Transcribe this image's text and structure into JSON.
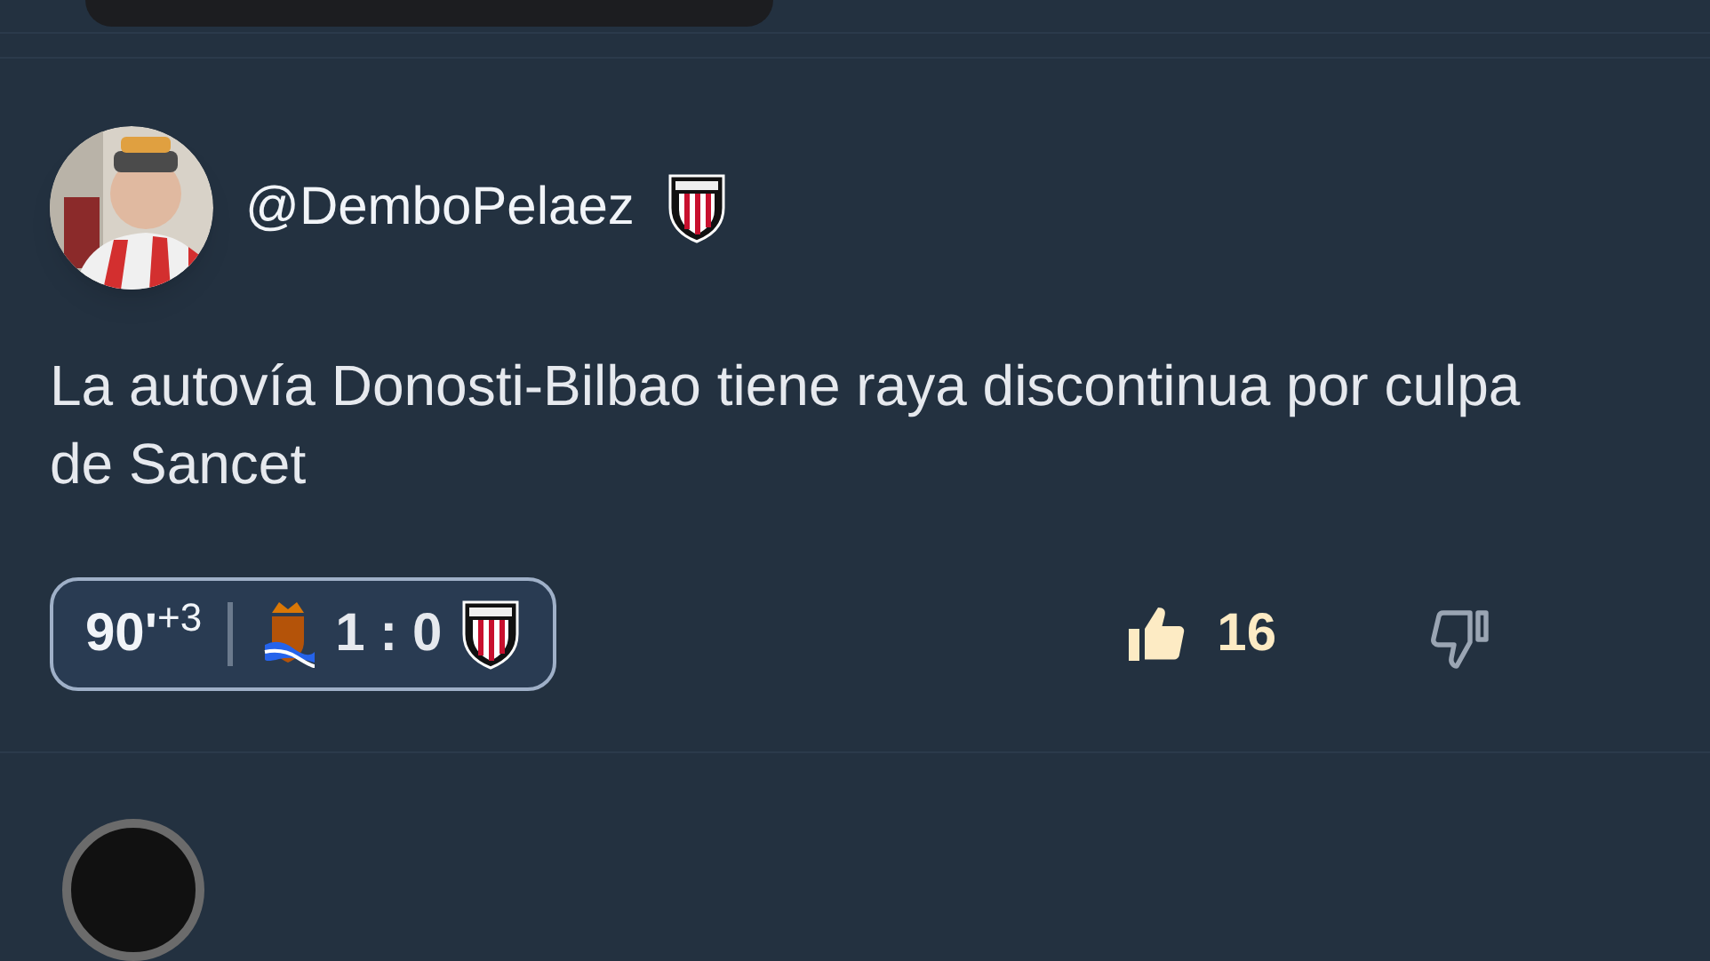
{
  "post": {
    "username": "@DemboPelaez",
    "text": "La autovía Donosti-Bilbao tiene raya discontinua por culpa de Sancet",
    "match": {
      "minute": "90'",
      "added": "+3",
      "score": "1 : 0"
    },
    "likes": "16",
    "liked": true,
    "disliked": false
  }
}
